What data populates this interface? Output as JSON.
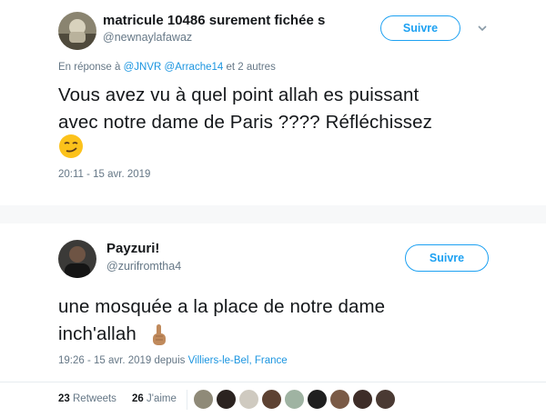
{
  "tweet1": {
    "display_name": "matricule 10486 surement fichée s",
    "handle": "@newnaylafawaz",
    "follow_label": "Suivre",
    "reply_prefix": "En réponse à",
    "reply_mention_1": "@JNVR",
    "reply_mention_2": "@Arrache14",
    "reply_suffix": "et 2 autres",
    "text_line1": "Vous avez vu à quel point allah es puissant",
    "text_line2": "avec notre dame de Paris ???? Réfléchissez",
    "emoji": "smirking-face-emoji",
    "timestamp": "20:11 - 15 avr. 2019"
  },
  "tweet2": {
    "display_name": "Payzuri!",
    "handle": "@zurifromtha4",
    "follow_label": "Suivre",
    "text_line1": "une mosquée a la place de notre dame",
    "text_line2": "inch'allah",
    "emoji": "index-pointing-up-emoji",
    "timestamp": "19:26 - 15 avr. 2019 depuis",
    "location": "Villiers-le-Bel, France",
    "retweets_count": "23",
    "retweets_label": "Retweets",
    "likes_count": "26",
    "likes_label": "J'aime"
  },
  "colors": {
    "accent": "#1da1f2",
    "link": "#1b95e0",
    "muted": "#657786"
  }
}
